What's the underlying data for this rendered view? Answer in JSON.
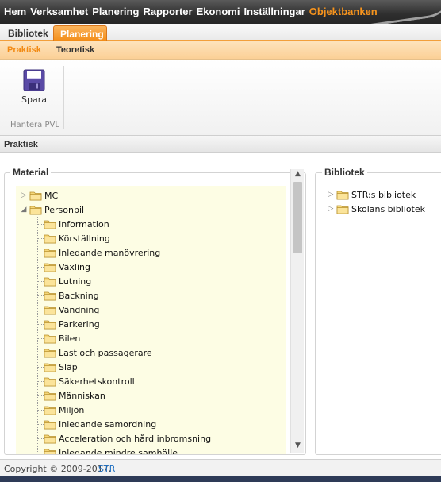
{
  "topnav": {
    "items": [
      "Hem",
      "Verksamhet",
      "Planering",
      "Rapporter",
      "Ekonomi",
      "Inställningar",
      "Objektbanken"
    ],
    "active_index": 6,
    "active_color": "#f7941d"
  },
  "ribbon_tabs": {
    "bibliotek": "Bibliotek",
    "planering": "Planering",
    "active": "Planering"
  },
  "sub_tabs": {
    "praktisk": "Praktisk",
    "teoretisk": "Teoretisk",
    "active": "Praktisk"
  },
  "ribbon": {
    "save_label": "Spara",
    "save_icon": "floppy-disk-icon",
    "group_label": "Hantera PVL"
  },
  "section_title": "Praktisk",
  "material": {
    "legend": "Material",
    "tree": {
      "mc": "MC",
      "personbil": "Personbil",
      "children": [
        "Information",
        "Körställning",
        "Inledande manövrering",
        "Växling",
        "Lutning",
        "Backning",
        "Vändning",
        "Parkering",
        "Bilen",
        "Last och passagerare",
        "Släp",
        "Säkerhetskontroll",
        "Människan",
        "Miljön",
        "Inledande samordning",
        "Acceleration och hård inbromsning",
        "Inledande mindre samhälle"
      ]
    }
  },
  "bibliotek": {
    "legend": "Bibliotek",
    "items": [
      "STR:s bibliotek",
      "Skolans bibliotek"
    ]
  },
  "footer": {
    "copyright": "Copyright © 2009-2017,",
    "link": "STR"
  },
  "colors": {
    "accent": "#f28a13",
    "tree_bg": "#fdfde4",
    "link": "#1f6fc1"
  }
}
